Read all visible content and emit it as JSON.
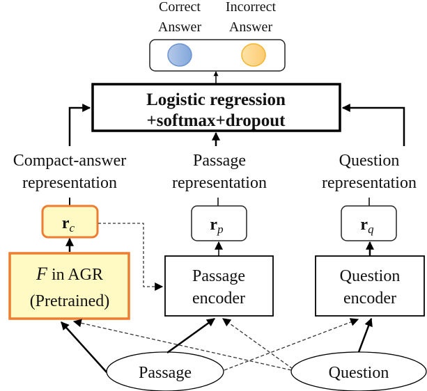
{
  "output": {
    "correct_label_line1": "Correct",
    "correct_label_line2": "Answer",
    "incorrect_label_line1": "Incorrect",
    "incorrect_label_line2": "Answer",
    "correct_color": "#4472c4",
    "incorrect_color": "#ed7d31"
  },
  "classifier": {
    "line1": "Logistic regression",
    "line2": "+softmax+dropout"
  },
  "representations": {
    "compact": {
      "line1": "Compact-answer",
      "line2": "representation",
      "symbol": "r",
      "subscript": "c"
    },
    "passage": {
      "line1": "Passage",
      "line2": "representation",
      "symbol": "r",
      "subscript": "p"
    },
    "question": {
      "line1": "Question",
      "line2": "representation",
      "symbol": "r",
      "subscript": "q"
    }
  },
  "encoders": {
    "agr": {
      "italic": "F",
      "line1_rest": " in AGR",
      "line2": "(Pretrained)"
    },
    "passage": {
      "line1": "Passage",
      "line2": "encoder"
    },
    "question": {
      "line1": "Question",
      "line2": "encoder"
    }
  },
  "inputs": {
    "passage": "Passage",
    "question": "Question"
  },
  "colors": {
    "highlight_fill": "#fff9c4",
    "highlight_border": "#ed7d31"
  }
}
